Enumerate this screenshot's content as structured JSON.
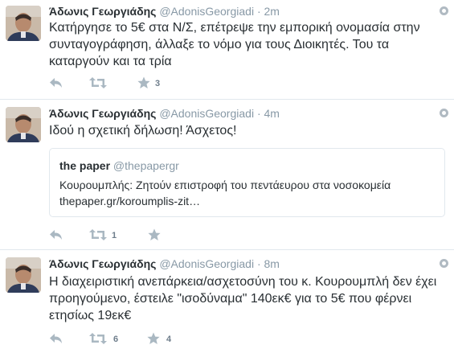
{
  "tweets": [
    {
      "name": "Άδωνις Γεωργιάδης",
      "handle": "@AdonisGeorgiadi",
      "separator": "·",
      "time": "2m",
      "text": "Κατήργησε το 5€ στα Ν/Σ, επέτρεψε την εμπορική ονομασία στην συνταγογράφηση, άλλαξε το νόμο για τους Διοικητές. Του τα καταργούν και τα τρία",
      "retweets": "",
      "favorites": "3"
    },
    {
      "name": "Άδωνις Γεωργιάδης",
      "handle": "@AdonisGeorgiadi",
      "separator": "·",
      "time": "4m",
      "text": "Ιδού η σχετική δήλωση! Άσχετος!",
      "retweets": "1",
      "favorites": "",
      "card": {
        "name": "the paper",
        "handle": "@thepapergr",
        "title": "Κουρουμπλής: Ζητούν επιστροφή του πεντάευρου στα νοσοκομεία",
        "url": "thepaper.gr/koroumplis-zit…"
      }
    },
    {
      "name": "Άδωνις Γεωργιάδης",
      "handle": "@AdonisGeorgiadi",
      "separator": "·",
      "time": "8m",
      "text": "Η διαχειριστική ανεπάρκεια/ασχετοσύνη του κ. Κουρουμπλή δεν έχει προηγούμενο, έστειλε \"ισοδύναμα\" 140εκ€ για το 5€ που φέρνει ετησίως 19εκ€",
      "retweets": "6",
      "favorites": "4"
    }
  ],
  "colors": {
    "name": "#292f33",
    "meta": "#8899a6",
    "icon": "#aab8c2",
    "divider": "#e1e8ed"
  },
  "icons": [
    "reply-icon",
    "retweet-icon",
    "favorite-icon",
    "gear-icon",
    "avatar"
  ]
}
